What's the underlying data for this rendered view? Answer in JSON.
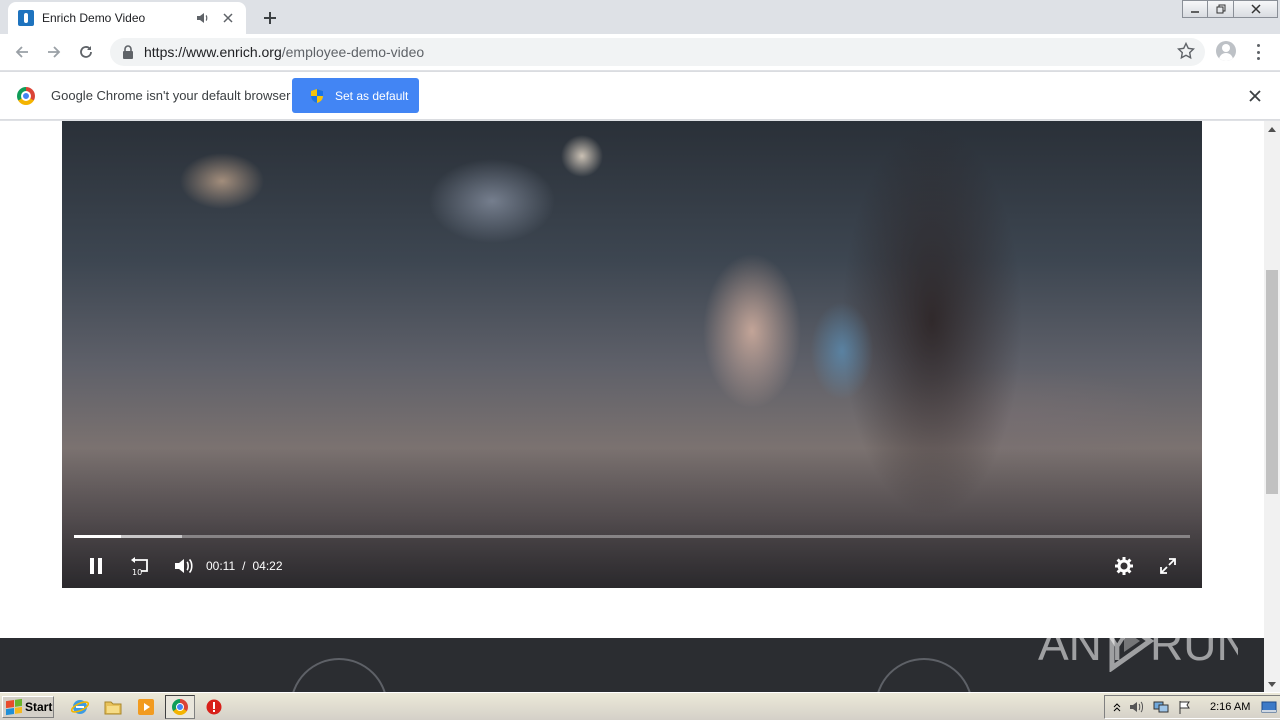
{
  "browser": {
    "tab": {
      "title": "Enrich Demo Video"
    },
    "url": {
      "scheme_host": "https://www.enrich.org",
      "path": "/employee-demo-video"
    }
  },
  "infobar": {
    "message": "Google Chrome isn't your default browser",
    "button_label": "Set as default"
  },
  "video_player": {
    "current_time": "00:11",
    "separator": "/",
    "duration": "04:22",
    "progress_fraction": 0.042,
    "buffered_fraction": 0.097,
    "rewind_seconds_label": "10"
  },
  "watermark": {
    "text_left": "ANY",
    "text_right": "RUN"
  },
  "taskbar": {
    "start_label": "Start",
    "clock": "2:16 AM"
  },
  "colors": {
    "infobar_button": "#4285f4",
    "footer_background": "#2b2d31",
    "taskbar": "#d4d0c8"
  },
  "icons": [
    "audio-playing-icon",
    "close-icon",
    "new-tab-icon",
    "back-icon",
    "forward-icon",
    "reload-icon",
    "lock-icon",
    "star-icon",
    "profile-icon",
    "menu-icon",
    "chrome-logo-icon",
    "uac-shield-icon",
    "pause-icon",
    "rewind-10-icon",
    "volume-icon",
    "settings-icon",
    "fullscreen-icon",
    "ie-icon",
    "explorer-icon",
    "media-player-icon",
    "chrome-icon",
    "stop-icon"
  ]
}
